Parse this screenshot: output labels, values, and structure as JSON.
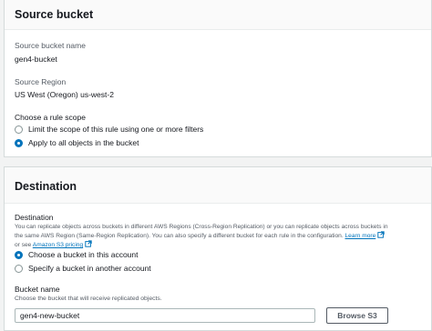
{
  "source": {
    "title": "Source bucket",
    "bucket_name_label": "Source bucket name",
    "bucket_name_value": "gen4-bucket",
    "region_label": "Source Region",
    "region_value": "US West (Oregon) us-west-2",
    "scope_label": "Choose a rule scope",
    "scope_options": [
      {
        "label": "Limit the scope of this rule using one or more filters",
        "checked": false
      },
      {
        "label": "Apply to all objects in the bucket",
        "checked": true
      }
    ]
  },
  "destination": {
    "title": "Destination",
    "label": "Destination",
    "description_line1": "You can replicate objects across buckets in different AWS Regions (Cross-Region Replication) or you can replicate objects across buckets in",
    "description_line2": "the same AWS Region (Same-Region Replication). You can also specify a different bucket for each rule in the configuration.",
    "learn_more": "Learn more",
    "description_or": "or see",
    "pricing_link": "Amazon S3 pricing",
    "options": [
      {
        "label": "Choose a bucket in this account",
        "checked": true
      },
      {
        "label": "Specify a bucket in another account",
        "checked": false
      }
    ],
    "bucket_name_label": "Bucket name",
    "bucket_name_hint": "Choose the bucket that will receive replicated objects.",
    "bucket_name_value": "gen4-new-bucket",
    "browse_button": "Browse S3"
  },
  "icons": {
    "external_link": "external-link-icon",
    "radio": "radio-button"
  },
  "colors": {
    "link": "#0073bb",
    "radio_selected": "#0073bb",
    "background": "#f2f3f3"
  }
}
